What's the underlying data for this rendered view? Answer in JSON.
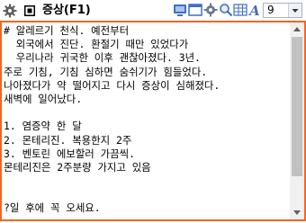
{
  "window": {
    "title": "증상(F1)"
  },
  "toolbar": {
    "icons": [
      "monitor-icon",
      "window-icon",
      "settings-icon",
      "zoom-icon",
      "grid-icon",
      "font-icon"
    ],
    "font_letter": "A",
    "font_size": "9"
  },
  "editor": {
    "lines": [
      "# 알레르기 천식. 예전부터",
      "  외국에서 진단. 환절기 때만 있었다가",
      "  우리나라 귀국한 이후 괜찮아졌다. 3년.",
      "주로 기침, 기침 심하면 숨쉬기가 힘들었다.",
      "나아졌다가 약 떨어지고 다시 증상이 심해졌다.",
      "새벽에 일어났다.",
      "",
      "1. 염증약 한 달",
      "2. 몬테리진. 복용한지 2주",
      "3. 벤토린 에보할러 가끔씩.",
      "몬테리진은 2주분량 가지고 있음",
      "",
      "",
      "?일 후에 꼭 오세요."
    ],
    "scroll_position": 0.0,
    "scroll_visible_fraction": 0.83
  },
  "colors": {
    "accent_border": "#f26522",
    "toolbar_blue": "#3d6fc4"
  }
}
